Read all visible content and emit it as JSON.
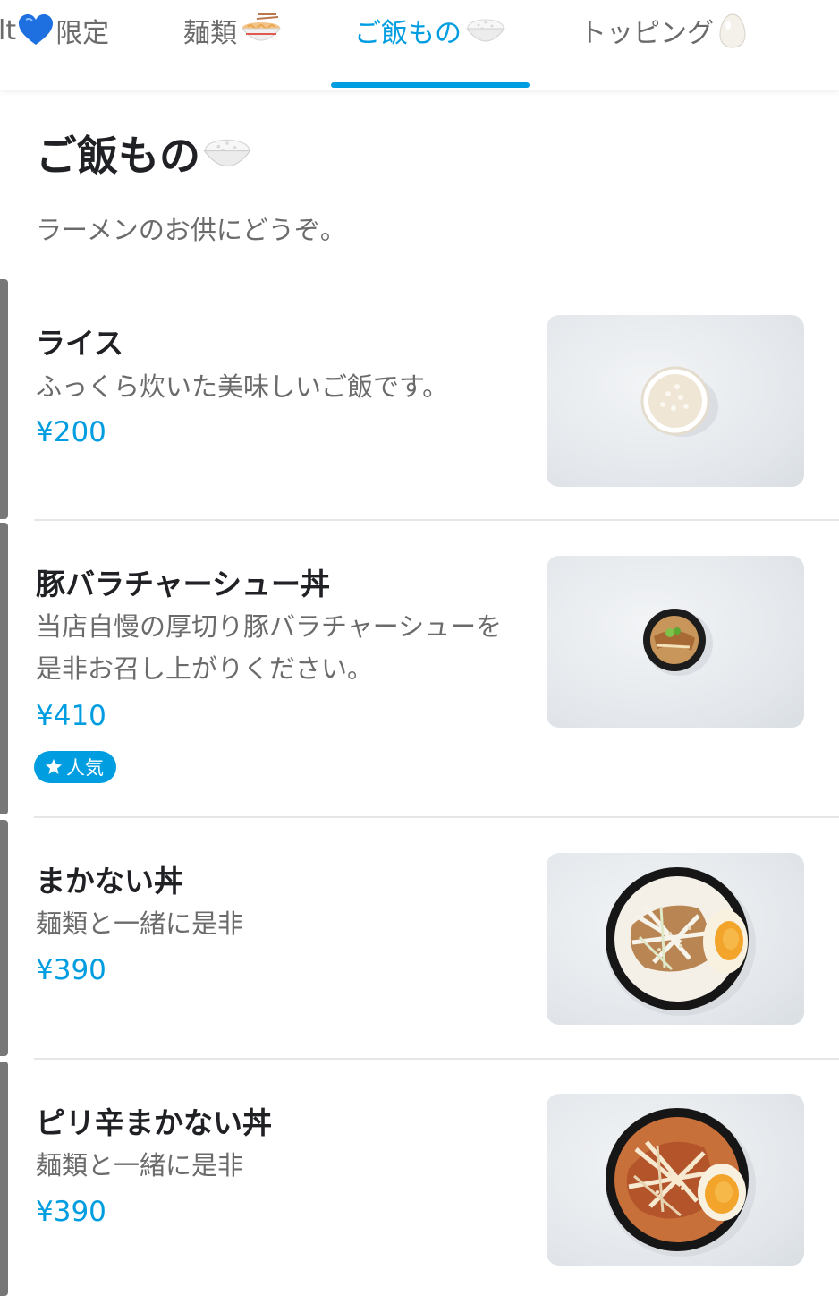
{
  "tabs": [
    {
      "label": "lt",
      "suffix": "限定",
      "icon": "blue-heart-icon",
      "active": false
    },
    {
      "label": "麺類",
      "icon": "ramen-bowl-icon",
      "active": false
    },
    {
      "label": "ご飯もの",
      "icon": "rice-bowl-icon",
      "active": true
    },
    {
      "label": "トッピング",
      "icon": "egg-icon",
      "active": false
    }
  ],
  "section": {
    "title": "ご飯もの",
    "title_icon": "rice-bowl-icon",
    "description": "ラーメンのお供にどうぞ。"
  },
  "items": [
    {
      "name": "ライス",
      "description": "ふっくら炊いた美味しいご飯です。",
      "price": "¥200",
      "photo": "rice-photo"
    },
    {
      "name": "豚バラチャーシュー丼",
      "description": "当店自慢の厚切り豚バラチャーシューを是非お召し上がりください。",
      "price": "¥410",
      "badge": "人気",
      "badge_icon": "star-icon",
      "photo": "chashu-don-photo"
    },
    {
      "name": "まかない丼",
      "description": "麺類と一緒に是非",
      "price": "¥390",
      "photo": "makanai-don-photo"
    },
    {
      "name": "ピリ辛まかない丼",
      "description": "麺類と一緒に是非",
      "price": "¥390",
      "photo": "spicy-makanai-don-photo"
    }
  ],
  "colors": {
    "accent": "#009de0",
    "text_primary": "#202125",
    "text_secondary": "#6b6b6b",
    "divider": "#e6e6e6",
    "badge_text": "#ffffff"
  }
}
